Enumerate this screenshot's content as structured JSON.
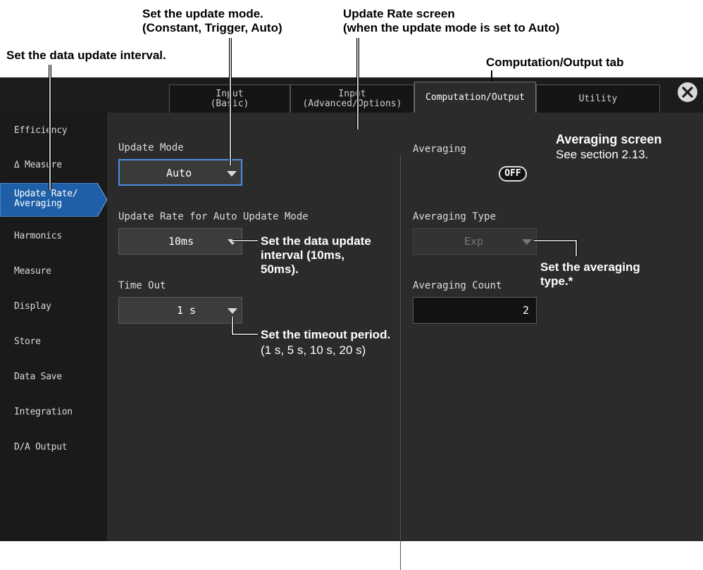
{
  "annotations": {
    "set_update_mode": [
      "Set the update mode.",
      "(Constant, Trigger, Auto)"
    ],
    "update_rate_screen": [
      "Update Rate screen",
      "(when the update mode is set to Auto)"
    ],
    "set_data_update_interval": "Set the data update interval.",
    "computation_output_tab": "Computation/Output tab",
    "averaging_screen_title": "Averaging screen",
    "averaging_screen_ref": "See section 2.13.",
    "interval_callout": [
      "Set the data update",
      "interval (10ms,",
      "50ms)."
    ],
    "timeout_callout": "Set the timeout period.",
    "timeout_values": "(1 s, 5 s, 10 s, 20 s)",
    "averaging_type_callout": [
      "Set the averaging",
      "type.*"
    ]
  },
  "tabs": [
    {
      "line1": "Input",
      "line2": "(Basic)"
    },
    {
      "line1": "Input",
      "line2": "(Advanced/Options)"
    },
    {
      "line1": "Computation/Output",
      "line2": ""
    },
    {
      "line1": "Utility",
      "line2": ""
    }
  ],
  "sidebar": {
    "items": [
      "Efficiency",
      "Δ Measure",
      "Update Rate/",
      "Averaging",
      "Harmonics",
      "Measure",
      "Display",
      "Store",
      "Data Save",
      "Integration",
      "D/A Output"
    ]
  },
  "update": {
    "mode_label": "Update Mode",
    "mode_value": "Auto",
    "rate_label": "Update Rate for Auto Update Mode",
    "rate_value": "10ms",
    "timeout_label": "Time Out",
    "timeout_value": "1 s"
  },
  "averaging": {
    "label": "Averaging",
    "toggle": "OFF",
    "type_label": "Averaging Type",
    "type_value": "Exp",
    "count_label": "Averaging Count",
    "count_value": "2"
  },
  "colors": {
    "screen_bg": "#2b2b2b",
    "sidebar_active": "#1f5fa8",
    "selected_border": "#4a90e2"
  }
}
